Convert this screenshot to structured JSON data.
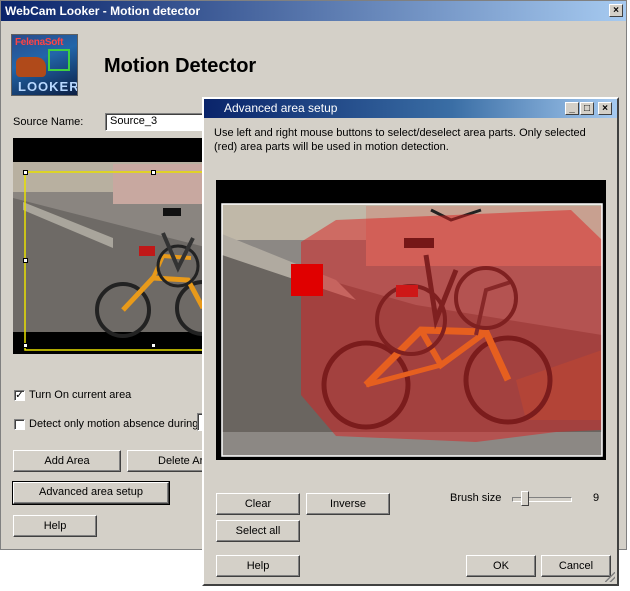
{
  "main_window": {
    "title": "WebCam Looker - Motion detector",
    "close_glyph": "×",
    "logo": {
      "top_text": "FelenaSoft",
      "bottom_text": "LOOKER"
    },
    "heading": "Motion Detector",
    "source_label": "Source Name:",
    "source_value": "Source_3",
    "turn_on_label": "Turn On current area",
    "turn_on_checked": "✓",
    "absence_label": "Detect only motion absence during",
    "add_area_label": "Add Area",
    "delete_area_label": "Delete Area",
    "advanced_label": "Advanced area setup",
    "help_label": "Help"
  },
  "dialog": {
    "title": "Advanced area setup",
    "min_glyph": "_",
    "max_glyph": "□",
    "close_glyph": "×",
    "instructions": "Use left and right mouse buttons to select/deselect area parts. Only selected (red) area parts will be used in motion detection.",
    "clear_label": "Clear",
    "inverse_label": "Inverse",
    "select_all_label": "Select all",
    "brush_label": "Brush size",
    "brush_value": "9",
    "brush_fraction": 0.2,
    "help_label": "Help",
    "ok_label": "OK",
    "cancel_label": "Cancel"
  },
  "colors": {
    "selection_red": "#e00000",
    "selection_overlay": "rgba(220,30,30,0.55)",
    "area_frame": "#e8e000"
  }
}
